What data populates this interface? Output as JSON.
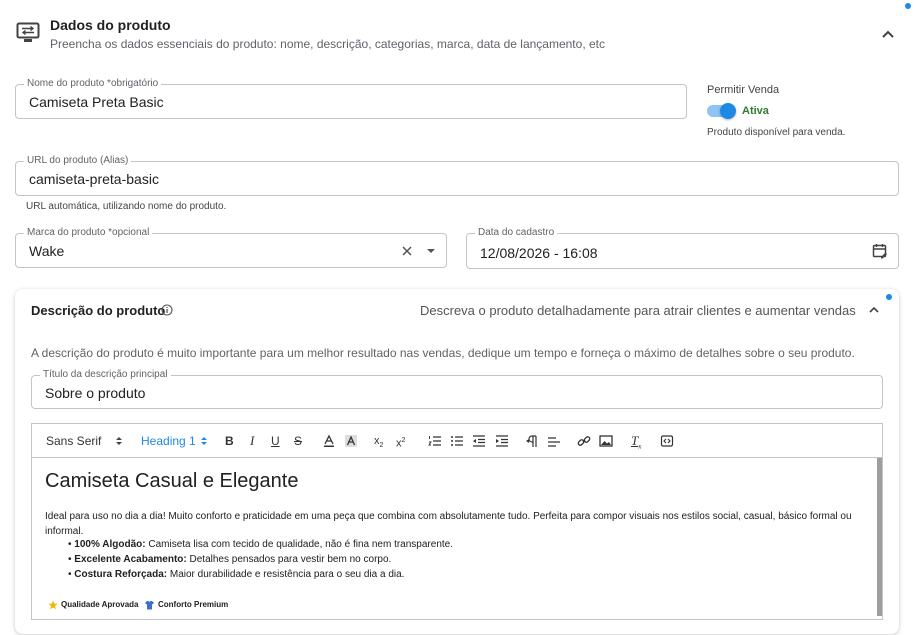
{
  "section": {
    "title": "Dados do produto",
    "subtitle": "Preencha os dados essenciais do produto: nome, descrição, categorias, marca, data de lançamento, etc",
    "icon": "monitor-transfer-icon",
    "collapse_icon": "chevron-up-icon"
  },
  "form": {
    "product_name": {
      "label": "Nome do produto *obrigatório",
      "value": "Camiseta Preta Basic"
    },
    "sale": {
      "label": "Permitir Venda",
      "state": "Ativa",
      "help": "Produto disponível para venda.",
      "enabled": true
    },
    "url": {
      "label": "URL do produto (Alias)",
      "value": "camiseta-preta-basic",
      "help": "URL automática, utilizando nome do produto."
    },
    "brand": {
      "label": "Marca do produto *opcional",
      "value": "Wake"
    },
    "date": {
      "label": "Data do cadastro",
      "value": "12/08/2026 - 16:08"
    }
  },
  "description": {
    "title": "Descrição do produto",
    "tagline": "Descreva o produto detalhadamente para atrair clientes e aumentar vendas",
    "note": "A descrição do produto é muito importante para um melhor resultado nas vendas, dedique um tempo e forneça o máximo de detalhes sobre o seu produto.",
    "main_title": {
      "label": "Título da descrição principal",
      "value": "Sobre o produto"
    }
  },
  "editor": {
    "font": "Sans Serif",
    "heading": "Heading 1",
    "heading_text": "Camiseta Casual e Elegante",
    "paragraph": "Ideal para uso no dia a dia! Muito conforto e praticidade em uma peça que combina com absolutamente tudo. Perfeita para compor visuais nos estilos social, casual, básico formal ou informal.",
    "bullets": [
      {
        "bold": "100% Algodão:",
        "text": "Camiseta lisa com tecido de qualidade, não é fina nem transparente."
      },
      {
        "bold": "Excelente Acabamento:",
        "text": "Detalhes pensados para vestir bem no corpo."
      },
      {
        "bold": "Costura Reforçada:",
        "text": "Maior durabilidade e resistência para o seu dia a dia."
      }
    ],
    "footer_tags": [
      "Qualidade Aprovada",
      "Conforto Premium"
    ]
  },
  "colors": {
    "accent": "#1e88e5",
    "active_green": "#2e7d32"
  }
}
